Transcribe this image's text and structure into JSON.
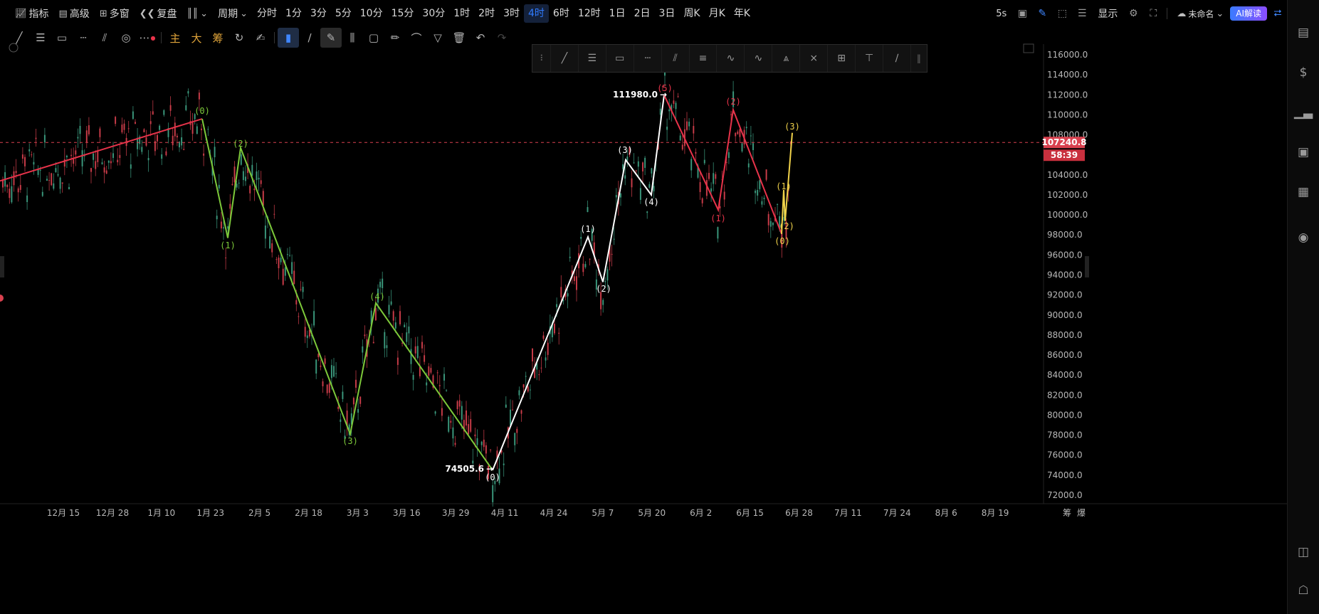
{
  "toolbar": {
    "indicator": "指标",
    "advanced": "高级",
    "multi_window": "多窗",
    "replay": "复盘",
    "period": "周期",
    "periods": [
      "分时",
      "1分",
      "3分",
      "5分",
      "10分",
      "15分",
      "30分",
      "1时",
      "2时",
      "3时",
      "4时",
      "6时",
      "12时",
      "1日",
      "2日",
      "3日",
      "周K",
      "月K",
      "年K"
    ],
    "active_period": "4时",
    "refresh": "5s",
    "display": "显示",
    "unnamed": "未命名",
    "ai": "AI解读"
  },
  "drawing_toolbar": {
    "main": "主",
    "big": "大",
    "chips": "筹"
  },
  "chart": {
    "price_axis": [
      "116000.0",
      "114000.0",
      "112000.0",
      "110000.0",
      "108000.0",
      "104000.0",
      "102000.0",
      "100000.0",
      "98000.0",
      "96000.0",
      "94000.0",
      "92000.0",
      "90000.0",
      "88000.0",
      "86000.0",
      "84000.0",
      "82000.0",
      "80000.0",
      "78000.0",
      "76000.0",
      "74000.0",
      "72000.0"
    ],
    "time_axis": [
      "12月 15",
      "12月 28",
      "1月 10",
      "1月 23",
      "2月 5",
      "2月 18",
      "3月 3",
      "3月 16",
      "3月 29",
      "4月 11",
      "4月 24",
      "5月 7",
      "5月 20",
      "6月 2",
      "6月 15",
      "6月 28",
      "7月 11",
      "7月 24",
      "8月 6",
      "8月 19"
    ],
    "corner_labels": [
      "筹",
      "爆"
    ],
    "current_price": "107240.8",
    "countdown": "58:39",
    "high_label": "111980.0",
    "low_label": "74505.6",
    "colors": {
      "up": "#3fa386",
      "down": "#d9414f",
      "red_wave": "#e8334a",
      "green_wave": "#7dc93a",
      "white_wave": "#ffffff",
      "yellow_wave": "#f0d24a",
      "price_badge": "#d9414f"
    },
    "waves": {
      "red_primary": [
        "(0)"
      ],
      "green": [
        "(2)",
        "(1)",
        "(4)",
        "(3)"
      ],
      "white": [
        "(0)",
        "(1)",
        "(2)",
        "(3)",
        "(4)",
        "(5)"
      ],
      "red_secondary": [
        "(1)",
        "(2)"
      ],
      "yellow": [
        "(0)",
        "(1)",
        "(2)",
        "(3)"
      ]
    }
  },
  "chart_data": {
    "type": "line",
    "title": "",
    "xlabel": "",
    "ylabel": "",
    "ylim": [
      71000,
      117000
    ],
    "series": [
      {
        "name": "",
        "color": "red",
        "points": [
          [
            0,
            103400
          ],
          [
            284,
            109600
          ]
        ],
        "labels": [
          "",
          "(0)"
        ]
      },
      {
        "name": "",
        "color": "green",
        "points": [
          [
            284,
            109600
          ],
          [
            320,
            97700
          ],
          [
            338,
            106700
          ],
          [
            492,
            78100
          ],
          [
            528,
            91200
          ],
          [
            692,
            74500
          ]
        ],
        "labels": [
          "(0)",
          "(1)",
          "(2)",
          "(3)",
          "(4)",
          "(0)"
        ]
      },
      {
        "name": "",
        "color": "white",
        "points": [
          [
            692,
            74500
          ],
          [
            826,
            97800
          ],
          [
            847,
            93300
          ],
          [
            879,
            105500
          ],
          [
            915,
            102000
          ],
          [
            933,
            111980
          ]
        ],
        "labels": [
          "(0)",
          "(1)",
          "(2)",
          "(3)",
          "(4)",
          "(5)"
        ]
      },
      {
        "name": "",
        "color": "red",
        "points": [
          [
            933,
            111980
          ],
          [
            1009,
            100500
          ],
          [
            1030,
            110500
          ],
          [
            1098,
            98100
          ]
        ],
        "labels": [
          "(5)",
          "(1)",
          "(2)",
          "(0)"
        ]
      },
      {
        "name": "",
        "color": "yellow",
        "points": [
          [
            1098,
            98100
          ],
          [
            1101,
            102500
          ],
          [
            1103,
            99400
          ],
          [
            1113,
            108200
          ]
        ],
        "labels": [
          "(0)",
          "(1)",
          "(2)",
          "(3)"
        ]
      }
    ]
  }
}
